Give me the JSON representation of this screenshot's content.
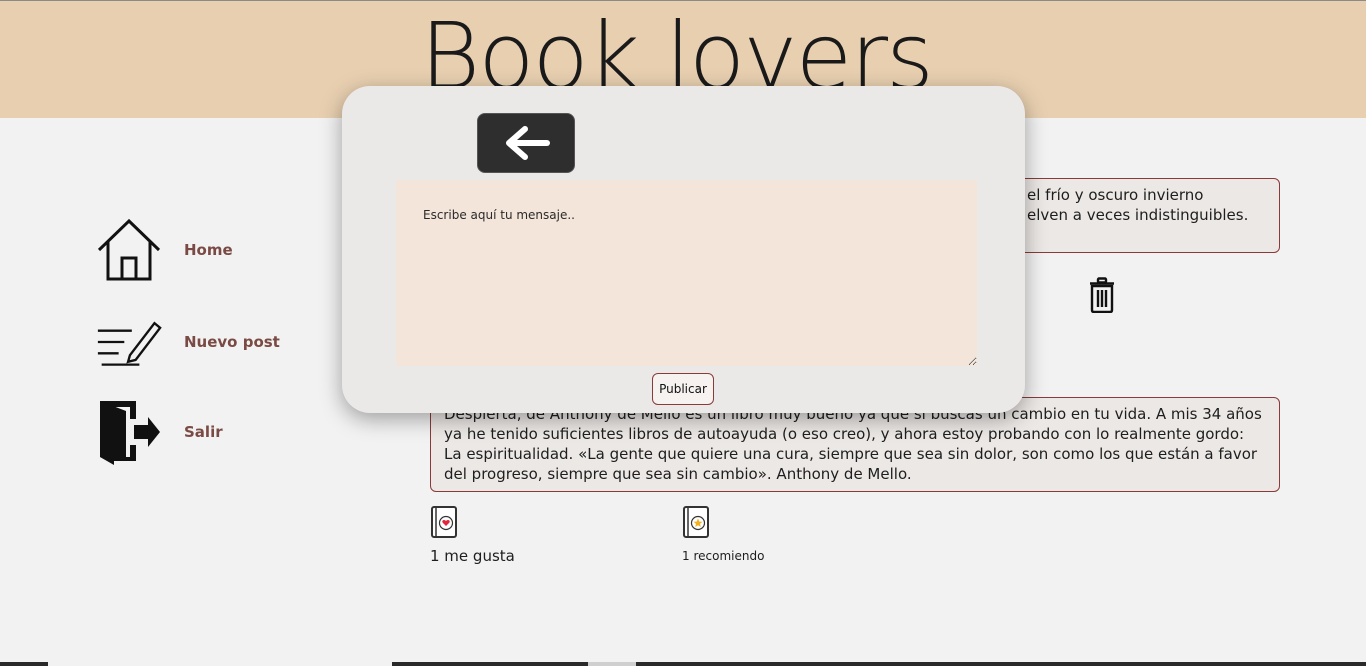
{
  "header": {
    "logo_text": "Book lovers"
  },
  "sidebar": {
    "items": [
      {
        "label": "Home",
        "icon": "house-icon"
      },
      {
        "label": "Nuevo post",
        "icon": "pencil-lines-icon"
      },
      {
        "label": "Salir",
        "icon": "door-exit-icon"
      }
    ]
  },
  "posts": [
    {
      "text_visible_line1": "el frío y oscuro invierno",
      "text_visible_line2": "elven a veces indistinguibles."
    },
    {
      "text": "Despierta, de Anthony de Mello es un libro muy bueno ya que si buscas un cambio en tu vida. A mis 34 años ya he tenido suficientes libros de autoayuda (o eso creo), y ahora estoy probando con lo realmente gordo: La espiritualidad. «La gente que quiere una cura, siempre que sea sin dolor, son como los que están a favor del progreso, siempre que sea sin cambio». Anthony de Mello.",
      "likes_label": "1 me gusta",
      "recommend_label": "1 recomiendo"
    }
  ],
  "modal": {
    "message_placeholder": "Escribe aquí tu mensaje..",
    "publish_label": "Publicar"
  },
  "colors": {
    "header_bg": "#e8cfb0",
    "accent": "#7a4a44",
    "border": "#8a3a3a",
    "textarea_bg": "#f4e5da"
  }
}
